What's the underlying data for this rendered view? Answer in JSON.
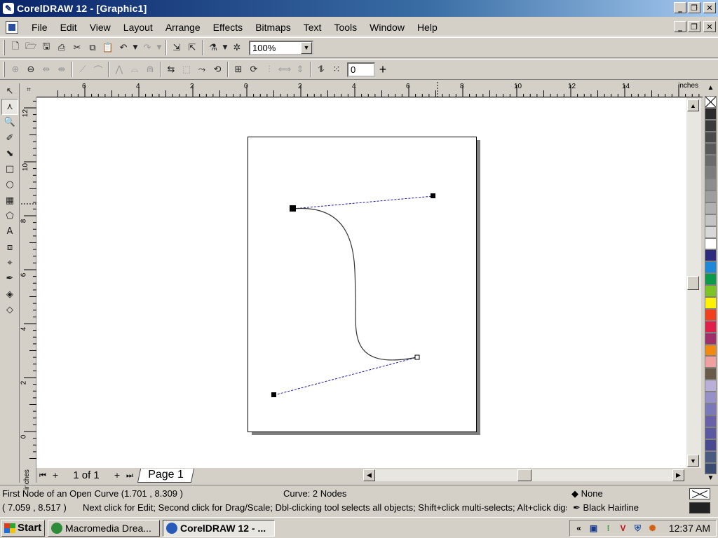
{
  "window": {
    "title": "CorelDRAW 12 - [Graphic1]"
  },
  "menu": [
    {
      "label": "File",
      "key": "F",
      "rest": "ile"
    },
    {
      "label": "Edit",
      "key": "E",
      "rest": "dit"
    },
    {
      "label": "View",
      "key": "V",
      "rest": "iew"
    },
    {
      "label": "Layout",
      "key": "L",
      "rest": "ayout"
    },
    {
      "label": "Arrange",
      "key": "A",
      "rest": "rrange"
    },
    {
      "label": "Effects",
      "key": "C",
      "rest": "Effe|c|ts"
    },
    {
      "label": "Bitmaps",
      "key": "B",
      "rest": "itmaps"
    },
    {
      "label": "Text",
      "key": "T",
      "rest": "ext"
    },
    {
      "label": "Tools",
      "key": "o",
      "rest": "T|o|ols"
    },
    {
      "label": "Window",
      "key": "W",
      "rest": "indow"
    },
    {
      "label": "Help",
      "key": "H",
      "rest": "elp"
    }
  ],
  "toolbar": {
    "zoom_value": "100%",
    "node_value": "0"
  },
  "ruler": {
    "units": "inches",
    "h_ticks": [
      "6",
      "4",
      "2",
      "0",
      "2",
      "4",
      "6",
      "8",
      "10",
      "12",
      "14"
    ],
    "v_ticks": [
      "12",
      "10",
      "8",
      "6",
      "4",
      "2",
      "0"
    ],
    "v_units": "inches"
  },
  "pages": {
    "count_label": "1 of 1",
    "tab_label": "Page 1"
  },
  "status": {
    "object_info": "First Node of an Open Curve (1.701 , 8.309 )",
    "curve_info": "Curve: 2 Nodes",
    "fill_label": "None",
    "coords": "( 7.059 , 8.517 )",
    "hint": "Next click for Edit; Second click for Drag/Scale; Dbl-clicking tool selects all objects; Shift+click multi-selects; Alt+click digs",
    "outline_label": "Black  Hairline"
  },
  "taskbar": {
    "start_label": "Start",
    "tasks": [
      "Macromedia Drea...",
      "CorelDRAW 12 - ..."
    ],
    "clock": "12:37 AM"
  },
  "palette": [
    "#2b2b2b",
    "#3a3a3a",
    "#4a4a4a",
    "#5a5a5a",
    "#6b6b6b",
    "#7c7c7c",
    "#8d8d8d",
    "#9e9e9e",
    "#b0b0b0",
    "#c4c4c4",
    "#d8d8d8",
    "#ffffff",
    "#2e2a7e",
    "#1e88d8",
    "#0a9a4a",
    "#7cc425",
    "#fff200",
    "#f04020",
    "#e0204a",
    "#a0306a",
    "#f08a10",
    "#f0a0a0",
    "#6a5a4a",
    "#b8b0d8",
    "#9890c8",
    "#7a78b8",
    "#6a60a8",
    "#5a58a0",
    "#4a4890",
    "#4a5a80",
    "#3a4a70"
  ]
}
